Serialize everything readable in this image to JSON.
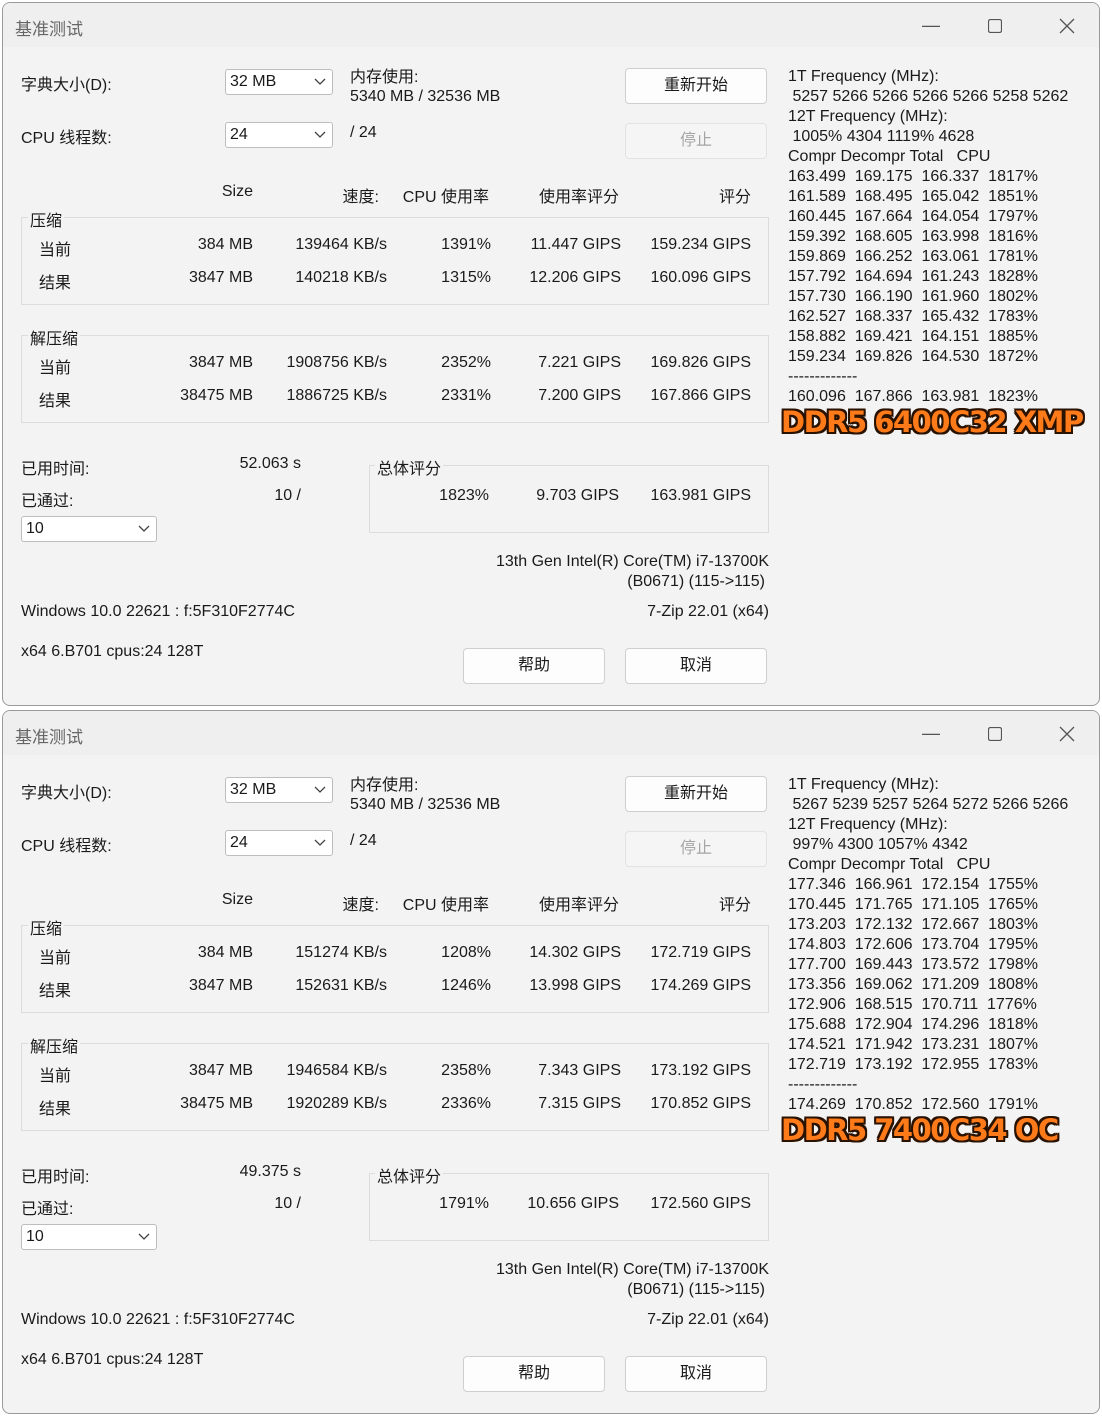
{
  "windows": [
    {
      "title": "基准测试",
      "dict_label": "字典大小(D):",
      "dict_value": "32 MB",
      "threads_label": "CPU 线程数:",
      "threads_value": "24",
      "threads_total": "/ 24",
      "mem_label": "内存使用:",
      "mem_value": "5340 MB / 32536 MB",
      "restart_label": "重新开始",
      "stop_label": "停止",
      "headers": {
        "size": "Size",
        "speed": "速度:",
        "cpu": "CPU 使用率",
        "rating_usage": "使用率评分",
        "rating": "评分"
      },
      "compress_label": "压缩",
      "compress_rows": [
        {
          "name": "当前",
          "size": "384 MB",
          "speed": "139464 KB/s",
          "cpu": "1391%",
          "usage": "11.447 GIPS",
          "rating": "159.234 GIPS"
        },
        {
          "name": "结果",
          "size": "3847 MB",
          "speed": "140218 KB/s",
          "cpu": "1315%",
          "usage": "12.206 GIPS",
          "rating": "160.096 GIPS"
        }
      ],
      "decompress_label": "解压缩",
      "decompress_rows": [
        {
          "name": "当前",
          "size": "3847 MB",
          "speed": "1908756 KB/s",
          "cpu": "2352%",
          "usage": "7.221 GIPS",
          "rating": "169.826 GIPS"
        },
        {
          "name": "结果",
          "size": "38475 MB",
          "speed": "1886725 KB/s",
          "cpu": "2331%",
          "usage": "7.200 GIPS",
          "rating": "167.866 GIPS"
        }
      ],
      "elapsed_label": "已用时间:",
      "elapsed_value": "52.063 s",
      "passed_label": "已通过:",
      "passed_value": "10 /",
      "passes_select": "10",
      "total_label": "总体评分",
      "total": {
        "cpu": "1823%",
        "usage": "9.703 GIPS",
        "rating": "163.981 GIPS"
      },
      "cpu_name": "13th Gen Intel(R) Core(TM) i7-13700K",
      "cpu_id": "(B0671) (115->115)",
      "os": "Windows 10.0 22621 :  f:5F310F2774C",
      "version": "7-Zip 22.01 (x64)",
      "build": "x64 6.B701 cpus:24 128T",
      "help_label": "帮助",
      "cancel_label": "取消",
      "right_lines": [
        "1T Frequency (MHz):",
        " 5257 5266 5266 5266 5266 5258 5262",
        "12T Frequency (MHz):",
        " 1005% 4304 1119% 4628",
        "Compr Decompr Total   CPU",
        "163.499  169.175  166.337  1817%",
        "161.589  168.495  165.042  1851%",
        "160.445  167.664  164.054  1797%",
        "159.392  168.605  163.998  1816%",
        "159.869  166.252  163.061  1781%",
        "157.792  164.694  161.243  1828%",
        "157.730  166.190  161.960  1802%",
        "162.527  168.337  165.432  1783%",
        "158.882  169.421  164.151  1885%",
        "159.234  169.826  164.530  1872%",
        "-------------",
        "160.096  167.866  163.981  1823%"
      ],
      "badge": "DDR5 6400C32 XMP"
    },
    {
      "title": "基准测试",
      "dict_label": "字典大小(D):",
      "dict_value": "32 MB",
      "threads_label": "CPU 线程数:",
      "threads_value": "24",
      "threads_total": "/ 24",
      "mem_label": "内存使用:",
      "mem_value": "5340 MB / 32536 MB",
      "restart_label": "重新开始",
      "stop_label": "停止",
      "headers": {
        "size": "Size",
        "speed": "速度:",
        "cpu": "CPU 使用率",
        "rating_usage": "使用率评分",
        "rating": "评分"
      },
      "compress_label": "压缩",
      "compress_rows": [
        {
          "name": "当前",
          "size": "384 MB",
          "speed": "151274 KB/s",
          "cpu": "1208%",
          "usage": "14.302 GIPS",
          "rating": "172.719 GIPS"
        },
        {
          "name": "结果",
          "size": "3847 MB",
          "speed": "152631 KB/s",
          "cpu": "1246%",
          "usage": "13.998 GIPS",
          "rating": "174.269 GIPS"
        }
      ],
      "decompress_label": "解压缩",
      "decompress_rows": [
        {
          "name": "当前",
          "size": "3847 MB",
          "speed": "1946584 KB/s",
          "cpu": "2358%",
          "usage": "7.343 GIPS",
          "rating": "173.192 GIPS"
        },
        {
          "name": "结果",
          "size": "38475 MB",
          "speed": "1920289 KB/s",
          "cpu": "2336%",
          "usage": "7.315 GIPS",
          "rating": "170.852 GIPS"
        }
      ],
      "elapsed_label": "已用时间:",
      "elapsed_value": "49.375 s",
      "passed_label": "已通过:",
      "passed_value": "10 /",
      "passes_select": "10",
      "total_label": "总体评分",
      "total": {
        "cpu": "1791%",
        "usage": "10.656 GIPS",
        "rating": "172.560 GIPS"
      },
      "cpu_name": "13th Gen Intel(R) Core(TM) i7-13700K",
      "cpu_id": "(B0671) (115->115)",
      "os": "Windows 10.0 22621 :  f:5F310F2774C",
      "version": "7-Zip 22.01 (x64)",
      "build": "x64 6.B701 cpus:24 128T",
      "help_label": "帮助",
      "cancel_label": "取消",
      "right_lines": [
        "1T Frequency (MHz):",
        " 5267 5239 5257 5264 5272 5266 5266",
        "12T Frequency (MHz):",
        " 997% 4300 1057% 4342",
        "Compr Decompr Total   CPU",
        "177.346  166.961  172.154  1755%",
        "170.445  171.765  171.105  1765%",
        "173.203  172.132  172.667  1803%",
        "174.803  172.606  173.704  1795%",
        "177.700  169.443  173.572  1798%",
        "173.356  169.062  171.209  1808%",
        "172.906  168.515  170.711  1776%",
        "175.688  172.904  174.296  1818%",
        "174.521  171.942  173.231  1807%",
        "172.719  173.192  172.955  1783%",
        "-------------",
        "174.269  170.852  172.560  1791%"
      ],
      "badge": "DDR5 7400C34 OC"
    }
  ]
}
